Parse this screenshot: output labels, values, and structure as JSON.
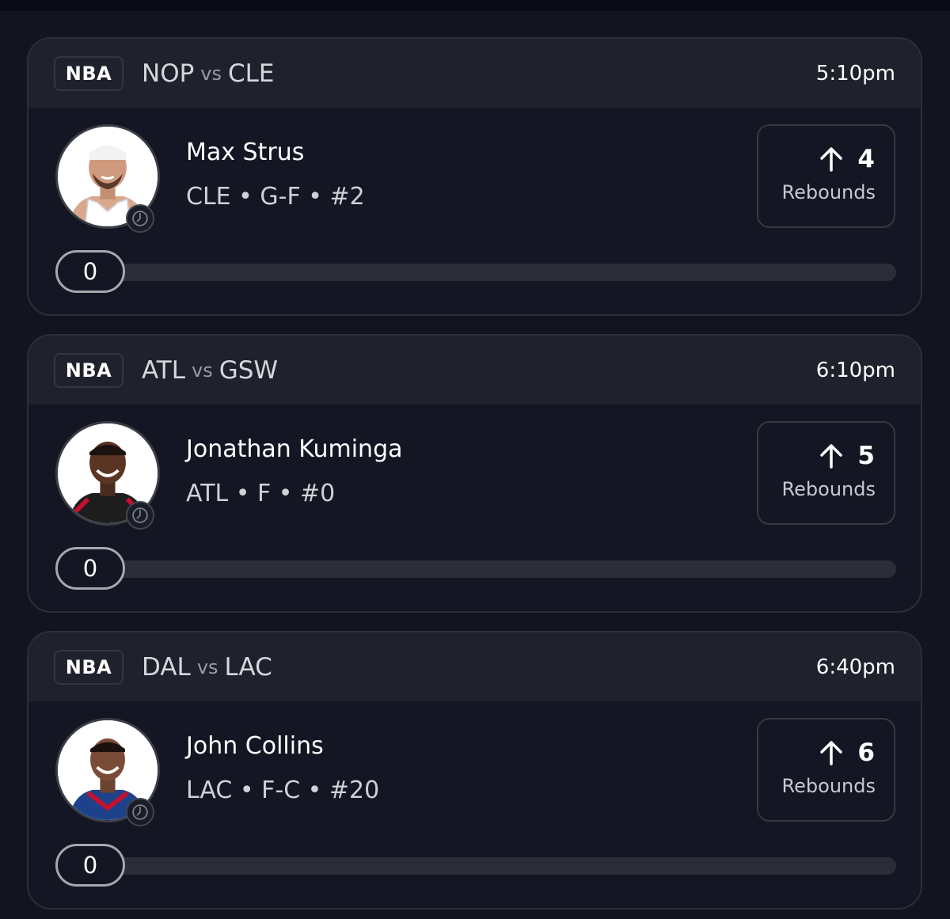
{
  "cards": [
    {
      "league": "NBA",
      "team_a": "NOP",
      "vs": "vs",
      "team_b": "CLE",
      "time": "5:10pm",
      "player_name": "Max Strus",
      "player_meta": "CLE • G-F • #2",
      "stat_value": "4",
      "stat_label": "Rebounds",
      "progress_value": "0",
      "progress_fraction": 0,
      "jersey_color": "#ffffff"
    },
    {
      "league": "NBA",
      "team_a": "ATL",
      "vs": "vs",
      "team_b": "GSW",
      "time": "6:10pm",
      "player_name": "Jonathan Kuminga",
      "player_meta": "ATL • F • #0",
      "stat_value": "5",
      "stat_label": "Rebounds",
      "progress_value": "0",
      "progress_fraction": 0,
      "jersey_color": "#1d1d1d"
    },
    {
      "league": "NBA",
      "team_a": "DAL",
      "vs": "vs",
      "team_b": "LAC",
      "time": "6:40pm",
      "player_name": "John Collins",
      "player_meta": "LAC • F-C • #20",
      "stat_value": "6",
      "stat_label": "Rebounds",
      "progress_value": "0",
      "progress_fraction": 0,
      "jersey_color": "#1d428a"
    }
  ],
  "icons": {
    "avatar": "player-headshot",
    "badge": "clock-icon",
    "direction": "arrow-up-icon"
  },
  "colors": {
    "background": "#121420",
    "card_header": "#1f212c",
    "card_border": "#2c2e3a",
    "text_primary": "#ffffff",
    "text_secondary": "#d0d1d6"
  }
}
